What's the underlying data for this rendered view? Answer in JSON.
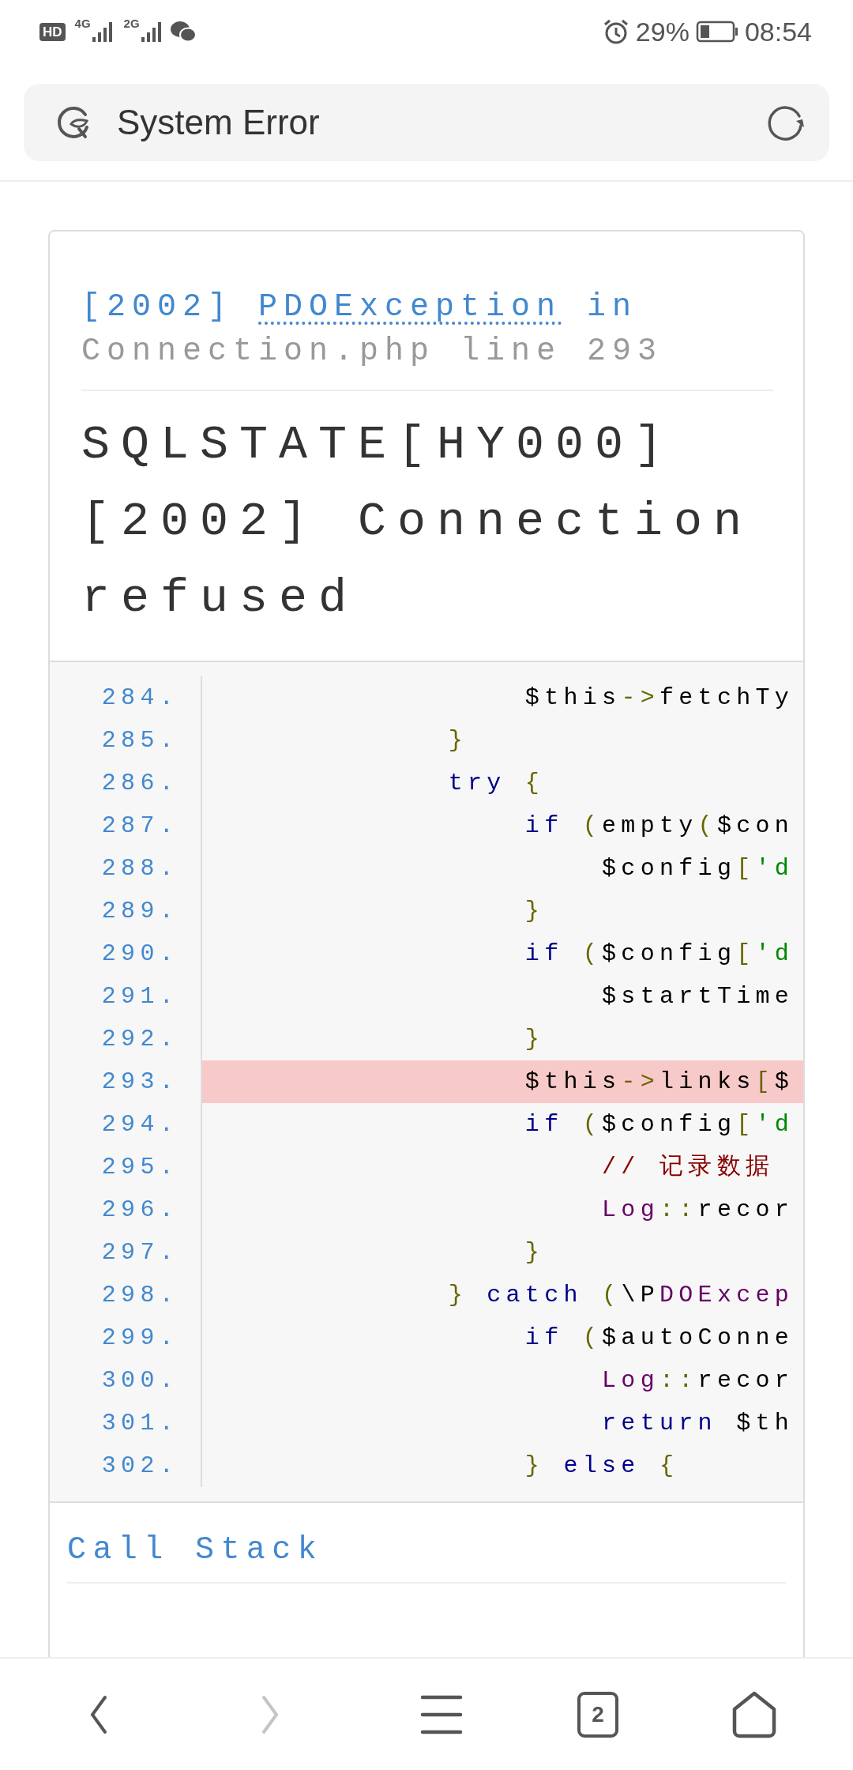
{
  "status_bar": {
    "hd_label": "HD",
    "network_types": [
      "4G",
      "2G"
    ],
    "battery_percent": "29%",
    "time": "08:54"
  },
  "address_bar": {
    "title": "System Error"
  },
  "error": {
    "code": "[2002]",
    "exception": "PDOException",
    "connector": "in",
    "location": "Connection.php line 293",
    "message": "SQLSTATE[HY000] [2002] Connection refused"
  },
  "source": {
    "lines": [
      {
        "number": "284.",
        "highlighted": false,
        "tokens": [
          {
            "text": "                $this",
            "kind": "plain"
          },
          {
            "text": "->",
            "kind": "punct"
          },
          {
            "text": "fetchTy",
            "kind": "plain"
          }
        ]
      },
      {
        "number": "285.",
        "highlighted": false,
        "tokens": [
          {
            "text": "            }",
            "kind": "punct"
          }
        ]
      },
      {
        "number": "286.",
        "highlighted": false,
        "tokens": [
          {
            "text": "            try",
            "kind": "keyword"
          },
          {
            "text": " {",
            "kind": "punct"
          }
        ]
      },
      {
        "number": "287.",
        "highlighted": false,
        "tokens": [
          {
            "text": "                if",
            "kind": "keyword"
          },
          {
            "text": " (",
            "kind": "punct"
          },
          {
            "text": "empty",
            "kind": "plain"
          },
          {
            "text": "(",
            "kind": "punct"
          },
          {
            "text": "$con",
            "kind": "plain"
          }
        ]
      },
      {
        "number": "288.",
        "highlighted": false,
        "tokens": [
          {
            "text": "                    $config",
            "kind": "plain"
          },
          {
            "text": "[",
            "kind": "punct"
          },
          {
            "text": "'d",
            "kind": "string"
          }
        ]
      },
      {
        "number": "289.",
        "highlighted": false,
        "tokens": [
          {
            "text": "                }",
            "kind": "punct"
          }
        ]
      },
      {
        "number": "290.",
        "highlighted": false,
        "tokens": [
          {
            "text": "                if",
            "kind": "keyword"
          },
          {
            "text": " (",
            "kind": "punct"
          },
          {
            "text": "$config",
            "kind": "plain"
          },
          {
            "text": "[",
            "kind": "punct"
          },
          {
            "text": "'d",
            "kind": "string"
          }
        ]
      },
      {
        "number": "291.",
        "highlighted": false,
        "tokens": [
          {
            "text": "                    $startTime",
            "kind": "plain"
          }
        ]
      },
      {
        "number": "292.",
        "highlighted": false,
        "tokens": [
          {
            "text": "                }",
            "kind": "punct"
          }
        ]
      },
      {
        "number": "293.",
        "highlighted": true,
        "tokens": [
          {
            "text": "                $this",
            "kind": "plain"
          },
          {
            "text": "->",
            "kind": "punct"
          },
          {
            "text": "links",
            "kind": "plain"
          },
          {
            "text": "[",
            "kind": "punct"
          },
          {
            "text": "$",
            "kind": "plain"
          }
        ]
      },
      {
        "number": "294.",
        "highlighted": false,
        "tokens": [
          {
            "text": "                if",
            "kind": "keyword"
          },
          {
            "text": " (",
            "kind": "punct"
          },
          {
            "text": "$config",
            "kind": "plain"
          },
          {
            "text": "[",
            "kind": "punct"
          },
          {
            "text": "'d",
            "kind": "string"
          }
        ]
      },
      {
        "number": "295.",
        "highlighted": false,
        "tokens": [
          {
            "text": "                    // 记录数据",
            "kind": "comment"
          }
        ]
      },
      {
        "number": "296.",
        "highlighted": false,
        "tokens": [
          {
            "text": "                    Log",
            "kind": "type"
          },
          {
            "text": "::",
            "kind": "punct"
          },
          {
            "text": "recor",
            "kind": "plain"
          }
        ]
      },
      {
        "number": "297.",
        "highlighted": false,
        "tokens": [
          {
            "text": "                }",
            "kind": "punct"
          }
        ]
      },
      {
        "number": "298.",
        "highlighted": false,
        "tokens": [
          {
            "text": "            }",
            "kind": "punct"
          },
          {
            "text": " catch",
            "kind": "keyword"
          },
          {
            "text": " (",
            "kind": "punct"
          },
          {
            "text": "\\P",
            "kind": "plain"
          },
          {
            "text": "DOExcep",
            "kind": "type"
          }
        ]
      },
      {
        "number": "299.",
        "highlighted": false,
        "tokens": [
          {
            "text": "                if",
            "kind": "keyword"
          },
          {
            "text": " (",
            "kind": "punct"
          },
          {
            "text": "$autoConne",
            "kind": "plain"
          }
        ]
      },
      {
        "number": "300.",
        "highlighted": false,
        "tokens": [
          {
            "text": "                    Log",
            "kind": "type"
          },
          {
            "text": "::",
            "kind": "punct"
          },
          {
            "text": "recor",
            "kind": "plain"
          }
        ]
      },
      {
        "number": "301.",
        "highlighted": false,
        "tokens": [
          {
            "text": "                    return",
            "kind": "keyword"
          },
          {
            "text": " $th",
            "kind": "plain"
          }
        ]
      },
      {
        "number": "302.",
        "highlighted": false,
        "tokens": [
          {
            "text": "                }",
            "kind": "punct"
          },
          {
            "text": " else",
            "kind": "keyword"
          },
          {
            "text": " {",
            "kind": "punct"
          }
        ]
      }
    ]
  },
  "call_stack": {
    "title": "Call Stack"
  },
  "bottom_nav": {
    "items": [
      {
        "kind": "back",
        "disabled": false
      },
      {
        "kind": "forward",
        "disabled": true
      },
      {
        "kind": "menu",
        "disabled": false
      },
      {
        "kind": "tabs",
        "label": "2",
        "disabled": false
      },
      {
        "kind": "home",
        "disabled": false
      }
    ]
  }
}
